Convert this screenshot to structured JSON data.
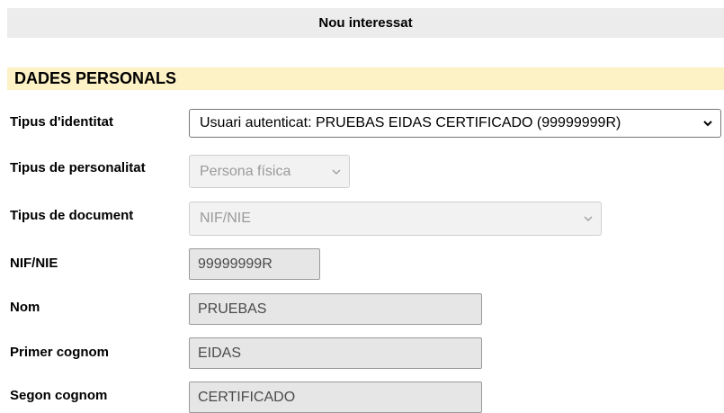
{
  "header": {
    "title": "Nou interessat"
  },
  "section": {
    "title": "DADES PERSONALS"
  },
  "fields": {
    "identity_type": {
      "label": "Tipus d'identitat",
      "value": "Usuari autenticat: PRUEBAS EIDAS CERTIFICADO (99999999R)"
    },
    "personality_type": {
      "label": "Tipus de personalitat",
      "value": "Persona física"
    },
    "document_type": {
      "label": "Tipus de document",
      "value": "NIF/NIE"
    },
    "nif": {
      "label": "NIF/NIE",
      "value": "99999999R"
    },
    "name": {
      "label": "Nom",
      "value": "PRUEBAS"
    },
    "surname1": {
      "label": "Primer cognom",
      "value": "EIDAS"
    },
    "surname2": {
      "label": "Segon cognom",
      "value": "CERTIFICADO"
    }
  },
  "icons": {
    "dropdown": "chevron-down-icon"
  }
}
